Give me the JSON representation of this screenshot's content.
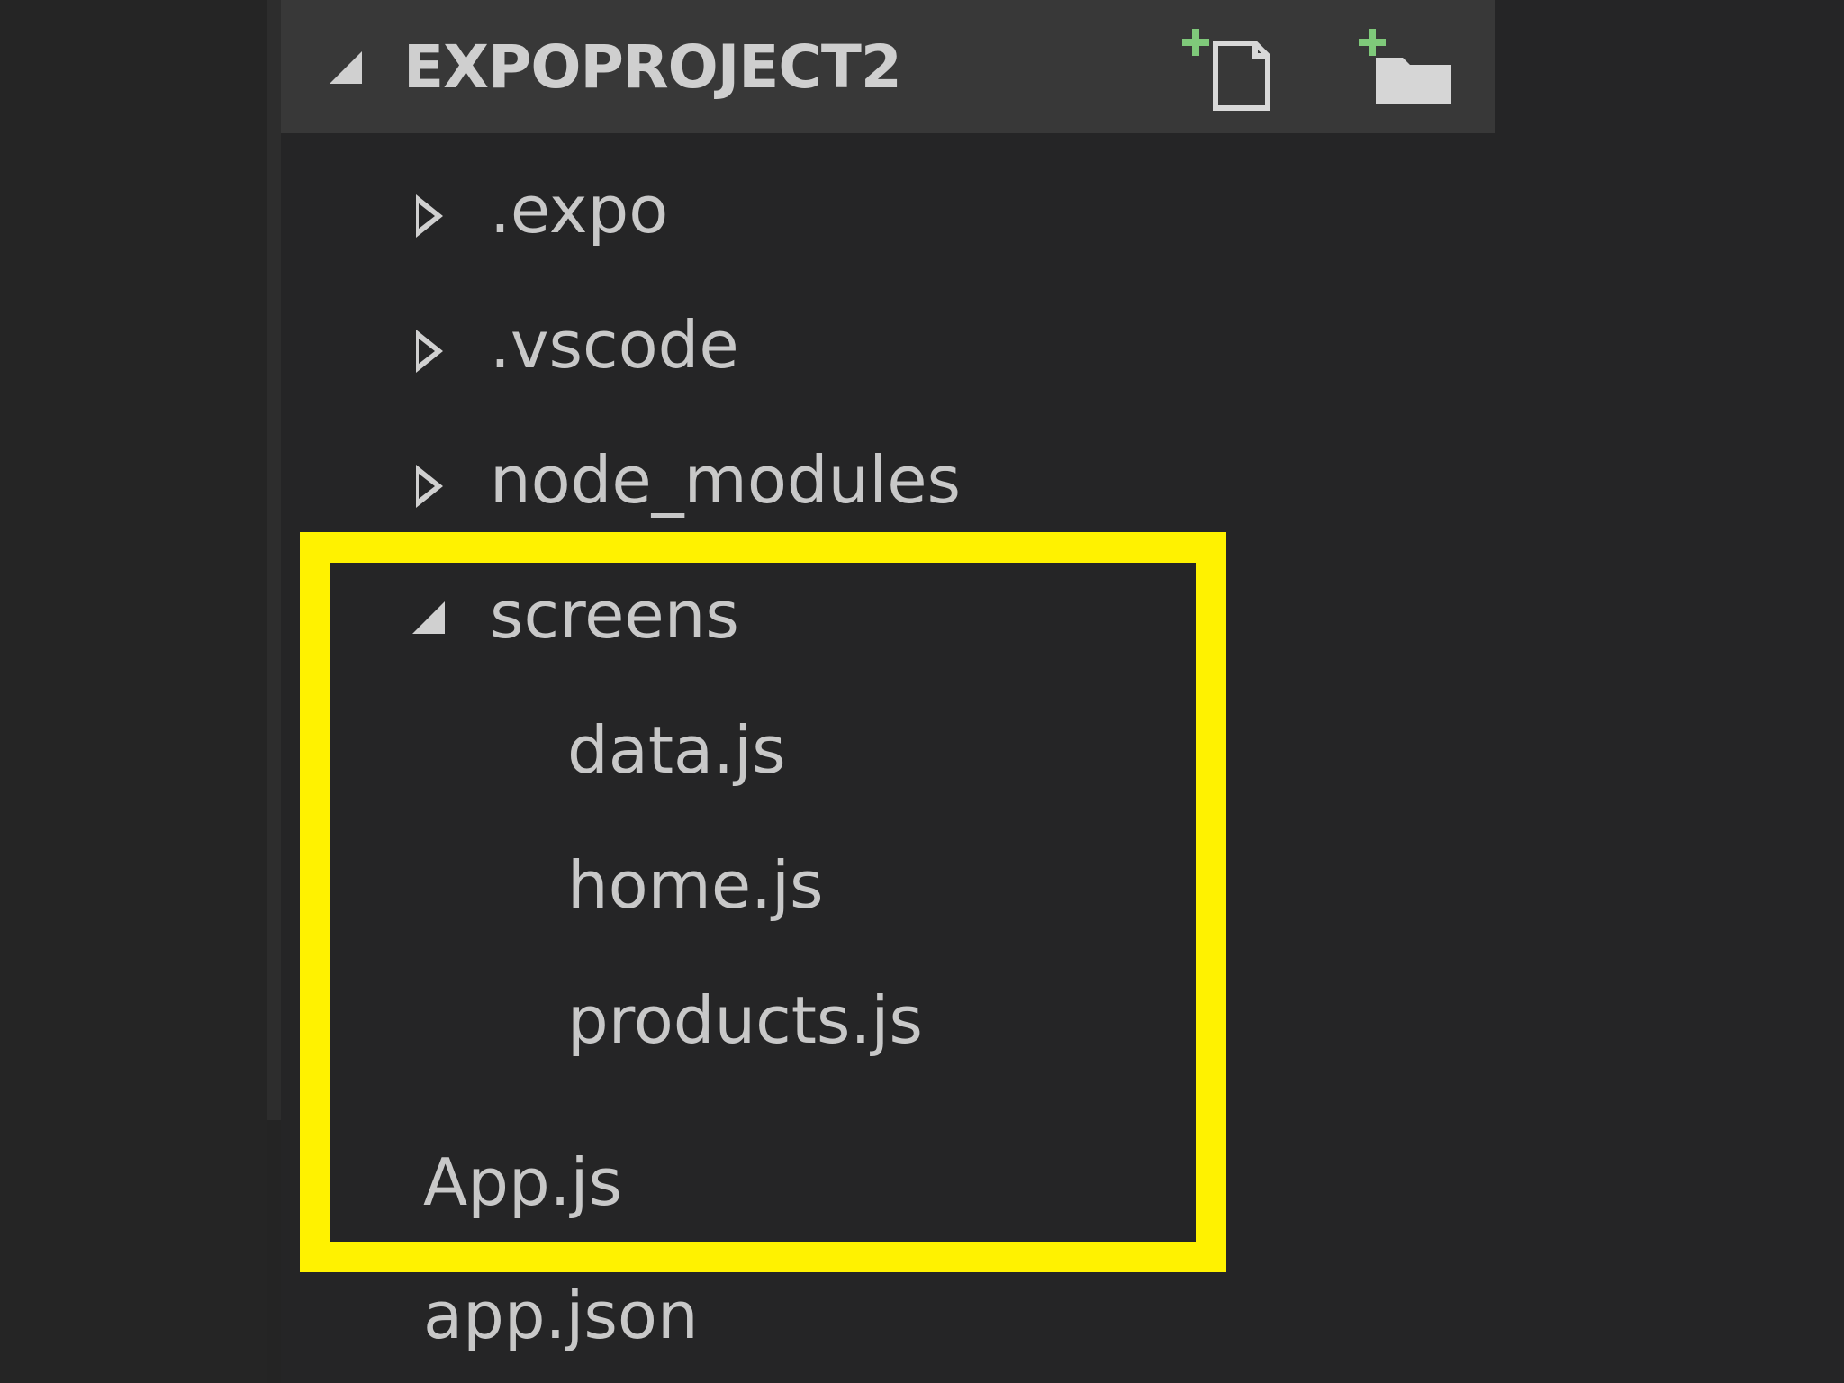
{
  "explorer": {
    "title": "EXPOPROJECT2",
    "actions": {
      "new_file_icon": "new-file-icon",
      "new_folder_icon": "new-folder-icon"
    },
    "items": [
      {
        "label": ".expo",
        "type": "folder",
        "state": "collapsed"
      },
      {
        "label": ".vscode",
        "type": "folder",
        "state": "collapsed"
      },
      {
        "label": "node_modules",
        "type": "folder",
        "state": "collapsed"
      },
      {
        "label": "screens",
        "type": "folder",
        "state": "expanded"
      },
      {
        "label": "data.js",
        "type": "file",
        "parent": "screens"
      },
      {
        "label": "home.js",
        "type": "file",
        "parent": "screens"
      },
      {
        "label": "products.js",
        "type": "file",
        "parent": "screens"
      },
      {
        "label": "App.js",
        "type": "file"
      },
      {
        "label": "app.json",
        "type": "file"
      }
    ]
  },
  "highlight": {
    "color": "#fff200"
  },
  "colors": {
    "background": "#252526",
    "header": "#383838",
    "text": "#c8c8c8",
    "plus": "#7fc97a"
  }
}
